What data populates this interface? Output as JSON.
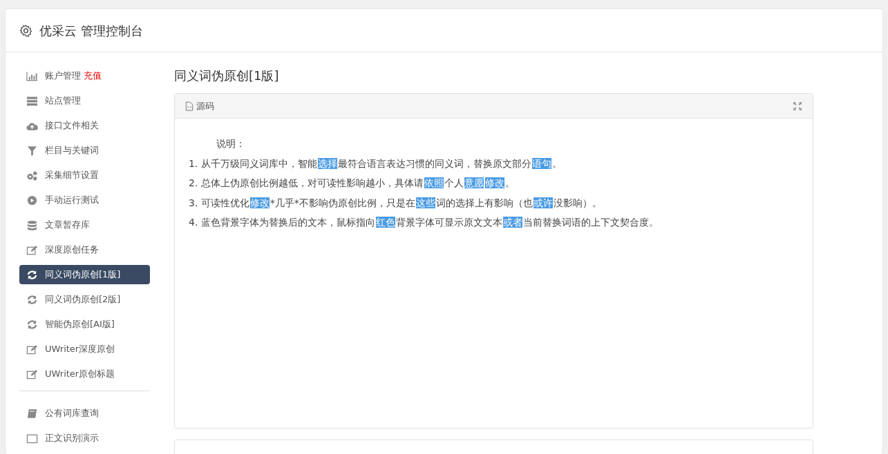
{
  "header": {
    "title": "优采云 管理控制台"
  },
  "sidebar": {
    "sections": [
      {
        "items": [
          {
            "label": "账户管理",
            "badge": "充值",
            "selected": false
          },
          {
            "label": "站点管理",
            "selected": false
          },
          {
            "label": "接口文件相关",
            "selected": false
          },
          {
            "label": "栏目与关键词",
            "selected": false
          },
          {
            "label": "采集细节设置",
            "selected": false
          },
          {
            "label": "手动运行测试",
            "selected": false
          },
          {
            "label": "文章暂存库",
            "selected": false
          },
          {
            "label": "深度原创任务",
            "selected": false
          },
          {
            "label": "同义词伪原创[1版]",
            "selected": true
          },
          {
            "label": "同义词伪原创[2版]",
            "selected": false
          },
          {
            "label": "智能伪原创[AI版]",
            "selected": false
          },
          {
            "label": "UWriter深度原创",
            "selected": false
          },
          {
            "label": "UWriter原创标题",
            "selected": false
          }
        ]
      },
      {
        "items": [
          {
            "label": "公有词库查询",
            "selected": false
          },
          {
            "label": "正文识别演示",
            "selected": false
          }
        ]
      }
    ]
  },
  "main": {
    "title": "同义词伪原创[1版]",
    "editor": {
      "tab": "源码",
      "heading": "说明：",
      "lines": [
        [
          {
            "text": "1. 从千万级同义词库中，智能",
            "highlighted": false
          },
          {
            "text": "选择",
            "highlighted": true
          },
          {
            "text": "最符合语言表达习惯的同义词，替换原文部分",
            "highlighted": false
          },
          {
            "text": "语句",
            "highlighted": true
          },
          {
            "text": "。",
            "highlighted": false
          }
        ],
        [
          {
            "text": "2. 总体上伪原创比例越低，对可读性影响越小，具体请",
            "highlighted": false
          },
          {
            "text": "依照",
            "highlighted": true
          },
          {
            "text": "个人",
            "highlighted": false
          },
          {
            "text": "意愿",
            "highlighted": true
          },
          {
            "text": "修改",
            "highlighted": true
          },
          {
            "text": "。",
            "highlighted": false
          }
        ],
        [
          {
            "text": "3. 可读性优化",
            "highlighted": false
          },
          {
            "text": "修改",
            "highlighted": true
          },
          {
            "text": "*几乎*不影响伪原创比例，只是在",
            "highlighted": false
          },
          {
            "text": "这些",
            "highlighted": true
          },
          {
            "text": "词的选择上有影响（也",
            "highlighted": false
          },
          {
            "text": "或许",
            "highlighted": true
          },
          {
            "text": "没影响）。",
            "highlighted": false
          }
        ],
        [
          {
            "text": "4. 蓝色背景字体为替换后的文本，鼠标指向",
            "highlighted": false
          },
          {
            "text": "红色",
            "highlighted": true
          },
          {
            "text": "背景字体可显示原文文本",
            "highlighted": false
          },
          {
            "text": "或者",
            "highlighted": true
          },
          {
            "text": "当前替换词语的上下文契合度。",
            "highlighted": false
          }
        ]
      ]
    }
  }
}
